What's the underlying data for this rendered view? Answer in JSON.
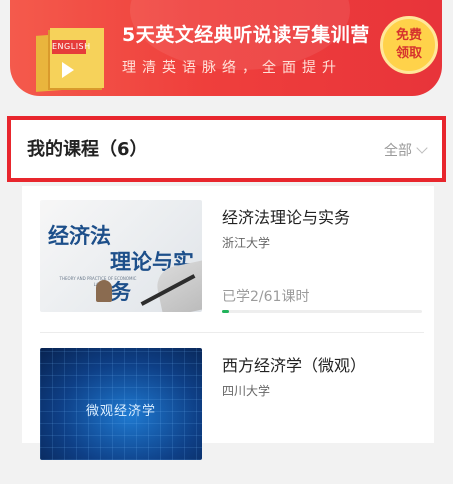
{
  "banner": {
    "title": "5天英文经典听说读写集训营",
    "subtitle": "理清英语脉络，全面提升",
    "book_label": "ENGLISH",
    "cta_line1": "免费",
    "cta_line2": "领取"
  },
  "section": {
    "title": "我的课程（6）",
    "all_label": "全部"
  },
  "courses": [
    {
      "title": "经济法理论与实务",
      "school": "浙江大学",
      "progress_text": "已学2/61课时",
      "progress": 0.033,
      "thumb_text_1": "经济法",
      "thumb_text_2": "理论与实务",
      "thumb_caption": "THEORY AND PRACTICE OF ECONOMIC LAW"
    },
    {
      "title": "西方经济学（微观）",
      "school": "四川大学",
      "thumb_text": "微观经济学"
    }
  ],
  "colors": {
    "accent_red": "#e8262d",
    "progress_green": "#21b35b",
    "cta_yellow": "#ffd24a"
  }
}
